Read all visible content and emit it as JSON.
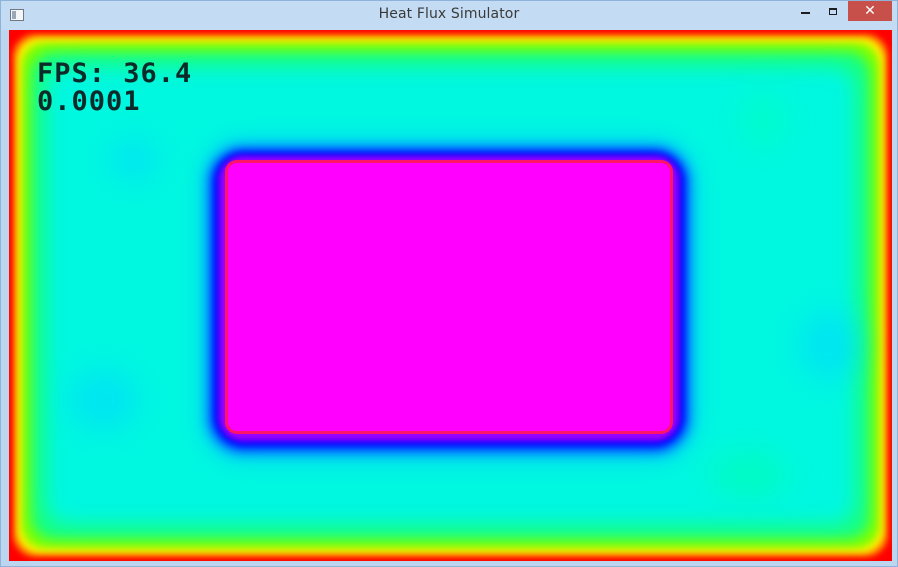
{
  "window": {
    "title": "Heat Flux Simulator",
    "controls": {
      "minimize_icon": "minimize-icon",
      "maximize_icon": "maximize-icon",
      "close_label": "✕"
    }
  },
  "simulation": {
    "fps_label": "FPS: 36.4",
    "value_label": "0.0001",
    "colors": {
      "hot": "#ff00ff",
      "boundary": "#ff0000",
      "ambient": "#00f7e0",
      "halo": "#0000ff"
    }
  }
}
